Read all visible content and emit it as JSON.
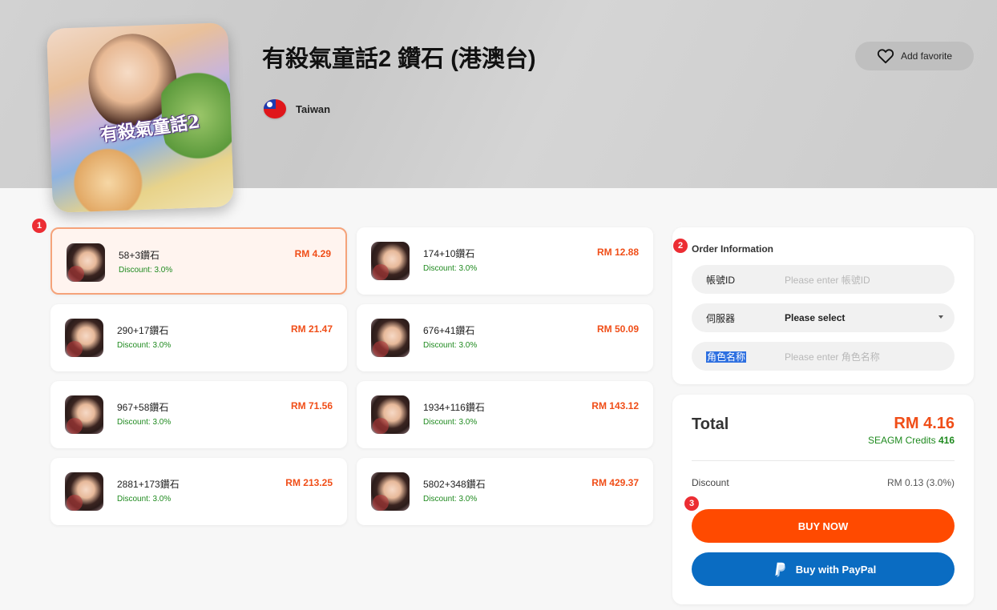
{
  "product": {
    "title": "有殺氣童話2 鑽石 (港澳台)",
    "region": "Taiwan",
    "cover_logo": "有殺氣童話2",
    "favorite_label": "Add favorite"
  },
  "steps": {
    "one": "1",
    "two": "2",
    "three": "3"
  },
  "packages": [
    {
      "name": "58+3鑽石",
      "discount": "Discount: 3.0%",
      "price": "RM 4.29",
      "selected": true
    },
    {
      "name": "174+10鑽石",
      "discount": "Discount: 3.0%",
      "price": "RM 12.88",
      "selected": false
    },
    {
      "name": "290+17鑽石",
      "discount": "Discount: 3.0%",
      "price": "RM 21.47",
      "selected": false
    },
    {
      "name": "676+41鑽石",
      "discount": "Discount: 3.0%",
      "price": "RM 50.09",
      "selected": false
    },
    {
      "name": "967+58鑽石",
      "discount": "Discount: 3.0%",
      "price": "RM 71.56",
      "selected": false
    },
    {
      "name": "1934+116鑽石",
      "discount": "Discount: 3.0%",
      "price": "RM 143.12",
      "selected": false
    },
    {
      "name": "2881+173鑽石",
      "discount": "Discount: 3.0%",
      "price": "RM 213.25",
      "selected": false
    },
    {
      "name": "5802+348鑽石",
      "discount": "Discount: 3.0%",
      "price": "RM 429.37",
      "selected": false
    }
  ],
  "order": {
    "title": "Order Information",
    "fields": [
      {
        "label": "帳號ID",
        "placeholder": "Please enter 帳號ID"
      },
      {
        "label": "伺服器",
        "value": "Please select"
      },
      {
        "label": "角色名称",
        "placeholder": "Please enter 角色名称"
      }
    ]
  },
  "summary": {
    "total_label": "Total",
    "total_price": "RM 4.16",
    "credits_label": "SEAGM Credits",
    "credits_value": "416",
    "discount_label": "Discount",
    "discount_value": "RM 0.13 (3.0%)",
    "buy_label": "BUY NOW",
    "paypal_label": "Buy with PayPal"
  },
  "colors": {
    "accent": "#ff4a00",
    "price": "#f04e18",
    "discount_green": "#1f8a1f",
    "paypal_blue": "#0a6cc2",
    "badge_red": "#ec2d33"
  }
}
